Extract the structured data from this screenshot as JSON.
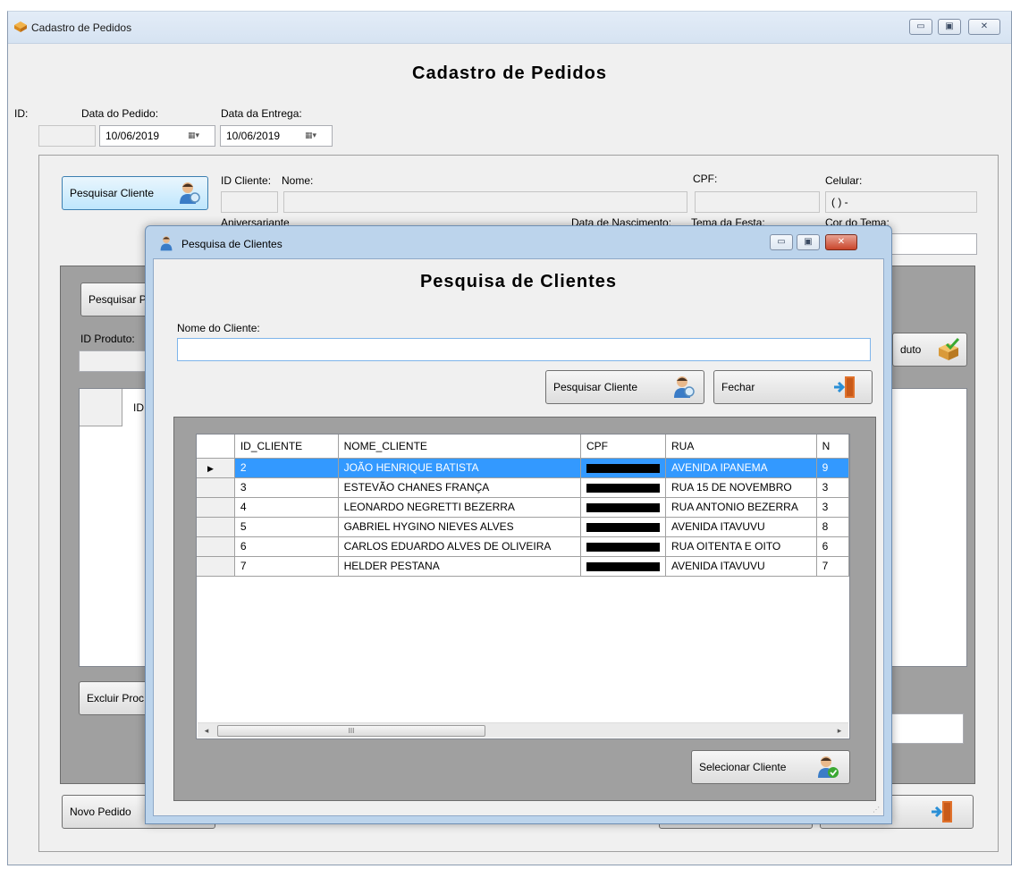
{
  "main_window": {
    "title": "Cadastro de Pedidos",
    "heading": "Cadastro de Pedidos",
    "caption": {
      "minimize": "▭",
      "maximize": "▣",
      "close": "✕"
    },
    "id_label": "ID:",
    "id_value": "",
    "order_date_label": "Data do Pedido:",
    "order_date": "10/06/2019",
    "delivery_date_label": "Data da Entrega:",
    "delivery_date": "10/06/2019",
    "search_client_button": "Pesquisar Cliente",
    "client_id_label": "ID Cliente:",
    "name_label": "Nome:",
    "cpf_label": "CPF:",
    "celular_label": "Celular:",
    "celular_value": "(  )     -",
    "aniversariante_label": "Aniversariante",
    "birth_date_label": "Data de Nascimento:",
    "party_theme_label": "Tema da Festa:",
    "theme_color_label": "Cor do Tema:",
    "search_product_button": "Pesquisar P",
    "product_id_label": "ID Produto:",
    "add_product_button": "duto",
    "grid_id_header": "ID",
    "delete_product_button": "Excluir Proc",
    "new_order_button": "Novo Pedido"
  },
  "dialog": {
    "title": "Pesquisa de Clientes",
    "heading": "Pesquisa de Clientes",
    "client_name_label": "Nome do Cliente:",
    "client_name_value": "",
    "search_button": "Pesquisar Cliente",
    "close_button": "Fechar",
    "select_button": "Selecionar Cliente",
    "scroll_thumb_label": "III",
    "columns": [
      "ID_CLIENTE",
      "NOME_CLIENTE",
      "CPF",
      "RUA",
      "N"
    ],
    "rows": [
      {
        "id": "2",
        "nome": "JOÃO HENRIQUE BATISTA",
        "rua": "AVENIDA IPANEMA",
        "n": "9",
        "selected": true
      },
      {
        "id": "3",
        "nome": "ESTEVÃO CHANES FRANÇA",
        "rua": "RUA 15 DE NOVEMBRO",
        "n": "3"
      },
      {
        "id": "4",
        "nome": "LEONARDO NEGRETTI BEZERRA",
        "rua": "RUA ANTONIO BEZERRA",
        "n": "3"
      },
      {
        "id": "5",
        "nome": "GABRIEL HYGINO NIEVES ALVES",
        "rua": "AVENIDA ITAVUVU",
        "n": "8"
      },
      {
        "id": "6",
        "nome": "CARLOS EDUARDO ALVES DE OLIVEIRA",
        "rua": "RUA OITENTA E OITO",
        "n": "6"
      },
      {
        "id": "7",
        "nome": "HELDER PESTANA",
        "rua": "AVENIDA ITAVUVU",
        "n": "7"
      }
    ]
  }
}
